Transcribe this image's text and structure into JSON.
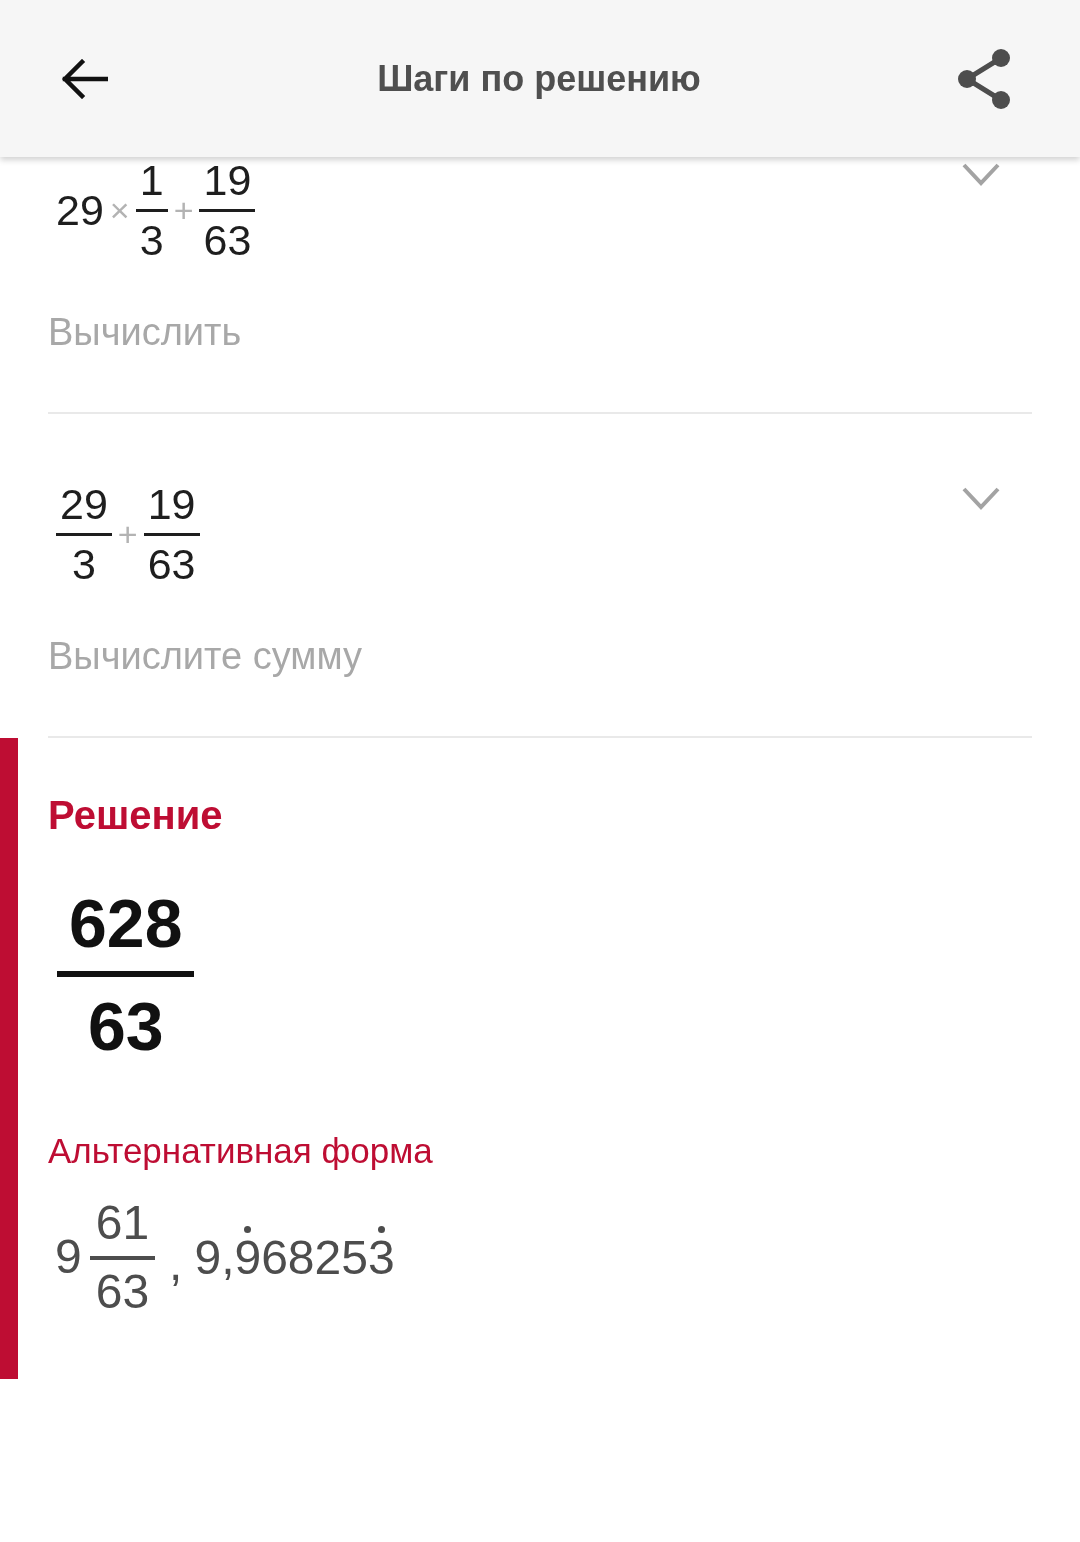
{
  "header": {
    "title": "Шаги по решению"
  },
  "steps": [
    {
      "expression": [
        {
          "kind": "number",
          "text": "29"
        },
        {
          "kind": "operator",
          "text": "×"
        },
        {
          "kind": "fraction",
          "numerator": "1",
          "denominator": "3"
        },
        {
          "kind": "operator",
          "text": "+"
        },
        {
          "kind": "fraction",
          "numerator": "19",
          "denominator": "63"
        }
      ],
      "expanded": false,
      "description": "Вычислить"
    },
    {
      "expression": [
        {
          "kind": "fraction",
          "numerator": "29",
          "denominator": "3"
        },
        {
          "kind": "operator",
          "text": "+"
        },
        {
          "kind": "fraction",
          "numerator": "19",
          "denominator": "63"
        }
      ],
      "expanded": false,
      "description": "Вычислите сумму"
    }
  ],
  "solution": {
    "heading": "Решение",
    "result": {
      "numerator": "628",
      "denominator": "63"
    },
    "alternative_heading": "Альтернативная форма",
    "separator": ",",
    "alternatives": [
      {
        "kind": "mixed",
        "whole": "9",
        "numerator": "61",
        "denominator": "63"
      },
      {
        "kind": "decimal",
        "parts": [
          {
            "text": "9,",
            "repeating": false
          },
          {
            "text": "9",
            "repeating": true
          },
          {
            "text": "6825",
            "repeating": false
          },
          {
            "text": "3",
            "repeating": true
          }
        ]
      }
    ]
  }
}
